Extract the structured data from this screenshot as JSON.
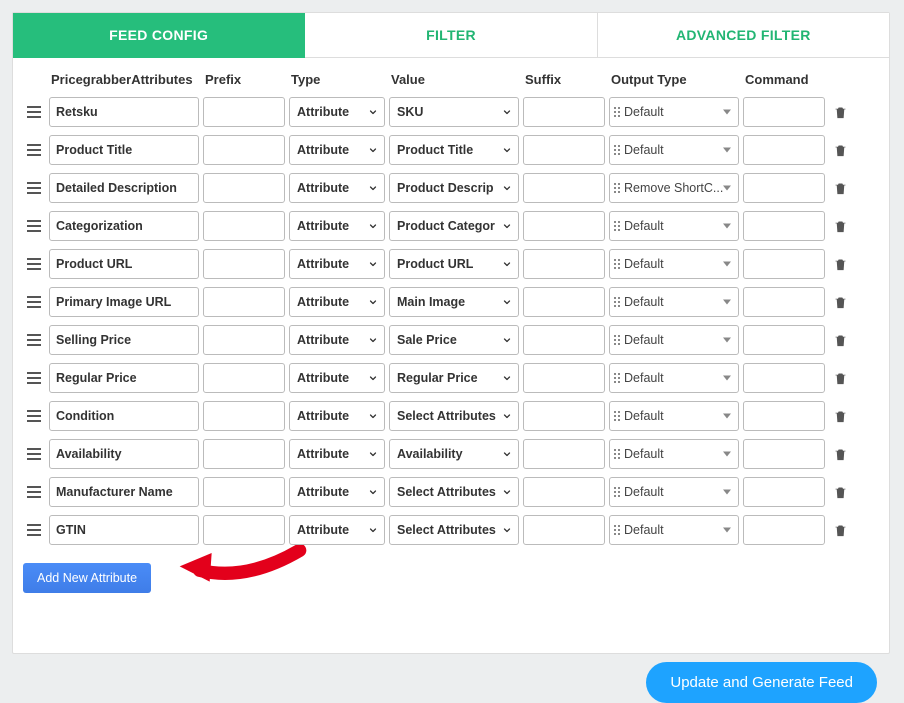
{
  "tabs": [
    {
      "label": "FEED CONFIG",
      "active": true
    },
    {
      "label": "FILTER",
      "active": false
    },
    {
      "label": "ADVANCED FILTER",
      "active": false
    }
  ],
  "headers": {
    "attr": "PricegrabberAttributes",
    "prefix": "Prefix",
    "type": "Type",
    "value": "Value",
    "suffix": "Suffix",
    "output": "Output Type",
    "command": "Command"
  },
  "rows": [
    {
      "attr": "Retsku",
      "prefix": "",
      "type": "Attribute",
      "value": "SKU",
      "suffix": "",
      "output": "Default",
      "command": ""
    },
    {
      "attr": "Product Title",
      "prefix": "",
      "type": "Attribute",
      "value": "Product Title",
      "suffix": "",
      "output": "Default",
      "command": ""
    },
    {
      "attr": "Detailed Description",
      "prefix": "",
      "type": "Attribute",
      "value": "Product Descrip",
      "suffix": "",
      "output": "Remove ShortC...",
      "command": ""
    },
    {
      "attr": "Categorization",
      "prefix": "",
      "type": "Attribute",
      "value": "Product Categor",
      "suffix": "",
      "output": "Default",
      "command": ""
    },
    {
      "attr": "Product URL",
      "prefix": "",
      "type": "Attribute",
      "value": "Product URL",
      "suffix": "",
      "output": "Default",
      "command": ""
    },
    {
      "attr": "Primary Image URL",
      "prefix": "",
      "type": "Attribute",
      "value": "Main Image",
      "suffix": "",
      "output": "Default",
      "command": ""
    },
    {
      "attr": "Selling Price",
      "prefix": "",
      "type": "Attribute",
      "value": "Sale Price",
      "suffix": "",
      "output": "Default",
      "command": ""
    },
    {
      "attr": "Regular Price",
      "prefix": "",
      "type": "Attribute",
      "value": "Regular Price",
      "suffix": "",
      "output": "Default",
      "command": ""
    },
    {
      "attr": "Condition",
      "prefix": "",
      "type": "Attribute",
      "value": "Select Attributes",
      "suffix": "",
      "output": "Default",
      "command": ""
    },
    {
      "attr": "Availability",
      "prefix": "",
      "type": "Attribute",
      "value": "Availability",
      "suffix": "",
      "output": "Default",
      "command": ""
    },
    {
      "attr": "Manufacturer Name",
      "prefix": "",
      "type": "Attribute",
      "value": "Select Attributes",
      "suffix": "",
      "output": "Default",
      "command": ""
    },
    {
      "attr": "GTIN",
      "prefix": "",
      "type": "Attribute",
      "value": "Select Attributes",
      "suffix": "",
      "output": "Default",
      "command": ""
    }
  ],
  "buttons": {
    "add": "Add New Attribute",
    "generate": "Update and Generate Feed"
  }
}
